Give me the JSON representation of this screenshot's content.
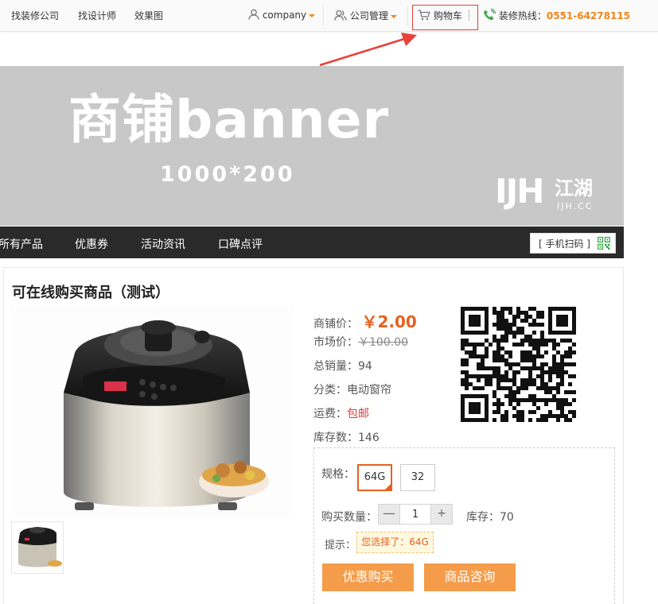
{
  "topbar": {
    "links": [
      "找装修公司",
      "找设计师",
      "效果图"
    ],
    "user": "company",
    "company_manage": "公司管理",
    "cart": "购物车",
    "hotline_label": "装修热线：",
    "hotline_number": "0551-64278115"
  },
  "banner": {
    "title": "商铺banner",
    "size": "1000*200",
    "logo_main": "IJH",
    "logo_cn": "江湖",
    "logo_domain": "IJH.CC"
  },
  "nav": {
    "items": [
      "所有产品",
      "优惠券",
      "活动资讯",
      "口碑点评"
    ],
    "mobile_scan": "[ 手机扫码 ]"
  },
  "product": {
    "title": "可在线购买商品（测试）",
    "shop_price_label": "商铺价：",
    "shop_price": "￥2.00",
    "market_price_label": "市场价：",
    "market_price": "￥100.00",
    "sales_label": "总销量：",
    "sales": "94",
    "category_label": "分类：",
    "category": "电动窗帘",
    "shipping_label": "运费：",
    "shipping": "包邮",
    "stock_label": "库存数：",
    "stock": "146",
    "spec_label": "规格：",
    "specs": [
      "64G",
      "32"
    ],
    "qty_label": "购买数量：",
    "qty_minus": "—",
    "qty_value": "1",
    "qty_plus": "+",
    "inventory_label": "库存：",
    "inventory": "70",
    "tip_label": "提示：",
    "tip": "您选择了：64G",
    "buy_button": "优惠购买",
    "consult_button": "商品咨询"
  },
  "colors": {
    "accent": "#f08519",
    "price": "#e4621f",
    "button": "#f59c4a",
    "nav_bg": "#2a2a2a",
    "banner_bg": "#c8c8c8",
    "annotation": "#e8413a"
  }
}
